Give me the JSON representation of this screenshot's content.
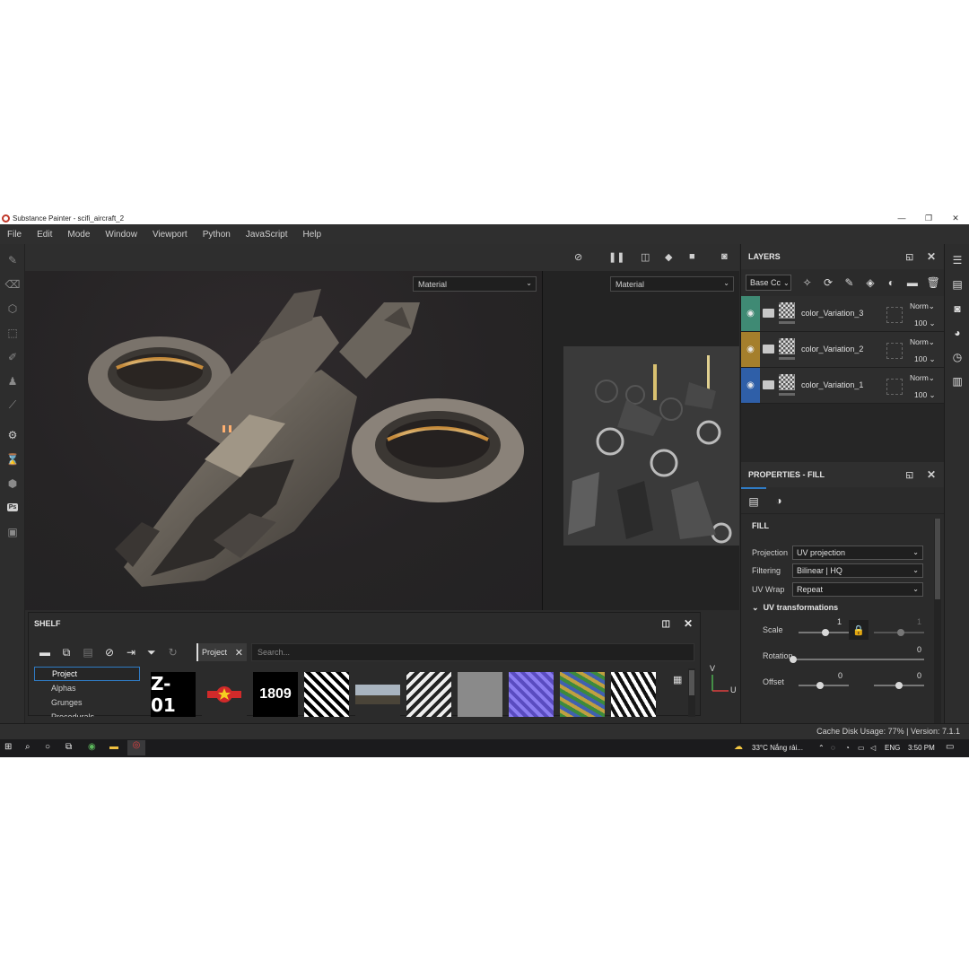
{
  "window": {
    "title": "Substance Painter - scifi_aircraft_2",
    "minimize": "—",
    "maximize": "❐",
    "close": "✕"
  },
  "menu": [
    "File",
    "Edit",
    "Mode",
    "Window",
    "Viewport",
    "Python",
    "JavaScript",
    "Help"
  ],
  "viewport": {
    "left_mode": "Material",
    "right_mode": "Material"
  },
  "layers_panel": {
    "title": "LAYERS",
    "blend_selector": "Base Cc",
    "layers": [
      {
        "name": "color_Variation_3",
        "blend": "Norm",
        "opacity": "100",
        "color": "#3f8a74"
      },
      {
        "name": "color_Variation_2",
        "blend": "Norm",
        "opacity": "100",
        "color": "#a57f2c"
      },
      {
        "name": "color_Variation_1",
        "blend": "Norm",
        "opacity": "100",
        "color": "#2f5fa8"
      }
    ]
  },
  "properties_panel": {
    "title": "PROPERTIES - FILL",
    "section": "FILL",
    "projection_label": "Projection",
    "projection_value": "UV projection",
    "filtering_label": "Filtering",
    "filtering_value": "Bilinear | HQ",
    "uvwrap_label": "UV Wrap",
    "uvwrap_value": "Repeat",
    "uv_transform_title": "UV transformations",
    "scale_label": "Scale",
    "scale_value": "1",
    "scale_value_locked": "1",
    "rotation_label": "Rotation",
    "rotation_value": "0",
    "offset_label": "Offset",
    "offset_x": "0",
    "offset_y": "0"
  },
  "shelf": {
    "title": "SHELF",
    "categories": [
      "Project",
      "Alphas",
      "Grunges",
      "Procedurals"
    ],
    "filter_chip": "Project",
    "search_placeholder": "Search...",
    "thumb_text_1": "Z-01",
    "thumb_text_3": "1809"
  },
  "axis": {
    "v": "V",
    "u": "U"
  },
  "status": {
    "text": "Cache Disk Usage: 77% | Version: 7.1.1"
  },
  "taskbar": {
    "weather": "33°C  Nắng rải...",
    "language": "ENG",
    "time": "3:50 PM"
  },
  "colors": {
    "accent": "#2f7bc4",
    "panel_bg": "#2b2b2b"
  }
}
